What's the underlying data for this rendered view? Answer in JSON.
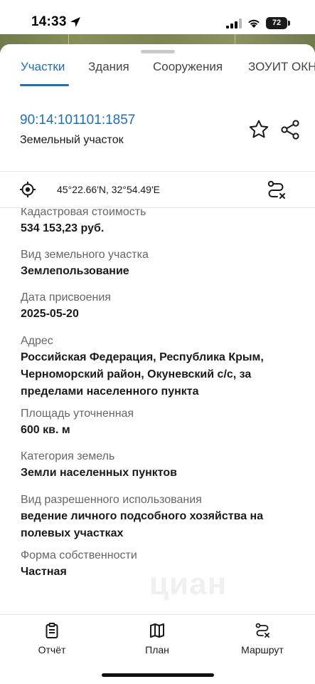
{
  "status_bar": {
    "time": "14:33",
    "battery": "72"
  },
  "tabs": [
    {
      "label": "Участки",
      "active": true
    },
    {
      "label": "Здания",
      "active": false
    },
    {
      "label": "Сооружения",
      "active": false
    },
    {
      "label": "ЗОУИТ ОКН",
      "active": false
    }
  ],
  "parcel": {
    "cadastral_number": "90:14:101101:1857",
    "object_type": "Земельный участок"
  },
  "location": {
    "coordinates": "45°22.66'N, 32°54.49'E"
  },
  "fields": [
    {
      "label": "Кадастровая стоимость",
      "value": "534 153,23 руб."
    },
    {
      "label": "Вид земельного участка",
      "value": "Землепользование"
    },
    {
      "label": "Дата присвоения",
      "value": "2025-05-20"
    },
    {
      "label": "Адрес",
      "value": "Российская Федерация, Республика Крым, Черноморский район, Окуневский с/с, за пределами населенного пункта"
    },
    {
      "label": "Площадь уточненная",
      "value": "600 кв. м"
    },
    {
      "label": "Категория земель",
      "value": "Земли населенных пунктов"
    },
    {
      "label": "Вид разрешенного использования",
      "value": "ведение личного подсобного хозяйства на полевых участках"
    },
    {
      "label": "Форма собственности",
      "value": "Частная"
    }
  ],
  "watermark": "циан",
  "bottom_nav": {
    "report": "Отчёт",
    "plan": "План",
    "route": "Маршрут"
  },
  "colors": {
    "accent": "#1f6fb6",
    "label": "#666666",
    "text": "#1a1a1a"
  }
}
